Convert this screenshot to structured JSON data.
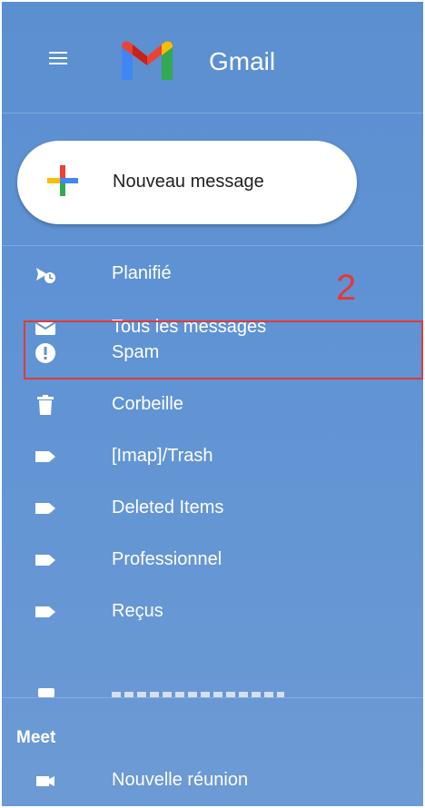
{
  "header": {
    "app_name": "Gmail",
    "brand_colors": {
      "red": "#ea4335",
      "blue": "#4285f4",
      "green": "#34a853",
      "yellow": "#fbbc04"
    }
  },
  "compose": {
    "label": "Nouveau message"
  },
  "nav": {
    "items": [
      {
        "label": "Planifié",
        "icon": "scheduled-icon"
      },
      {
        "label": "Tous les messages",
        "icon": "mail-icon"
      },
      {
        "label": "Spam",
        "icon": "spam-icon"
      },
      {
        "label": "Corbeille",
        "icon": "trash-icon"
      },
      {
        "label": "[Imap]/Trash",
        "icon": "label-icon"
      },
      {
        "label": "Deleted Items",
        "icon": "label-icon"
      },
      {
        "label": "Professionnel",
        "icon": "label-icon"
      },
      {
        "label": "Reçus",
        "icon": "label-icon"
      }
    ]
  },
  "meet": {
    "title": "Meet",
    "items": [
      {
        "label": "Nouvelle réunion",
        "icon": "video-icon"
      }
    ]
  },
  "annotation": {
    "number": "2",
    "highlight_color": "#e53935"
  },
  "theme": {
    "panel_color": "#5f93d4"
  }
}
